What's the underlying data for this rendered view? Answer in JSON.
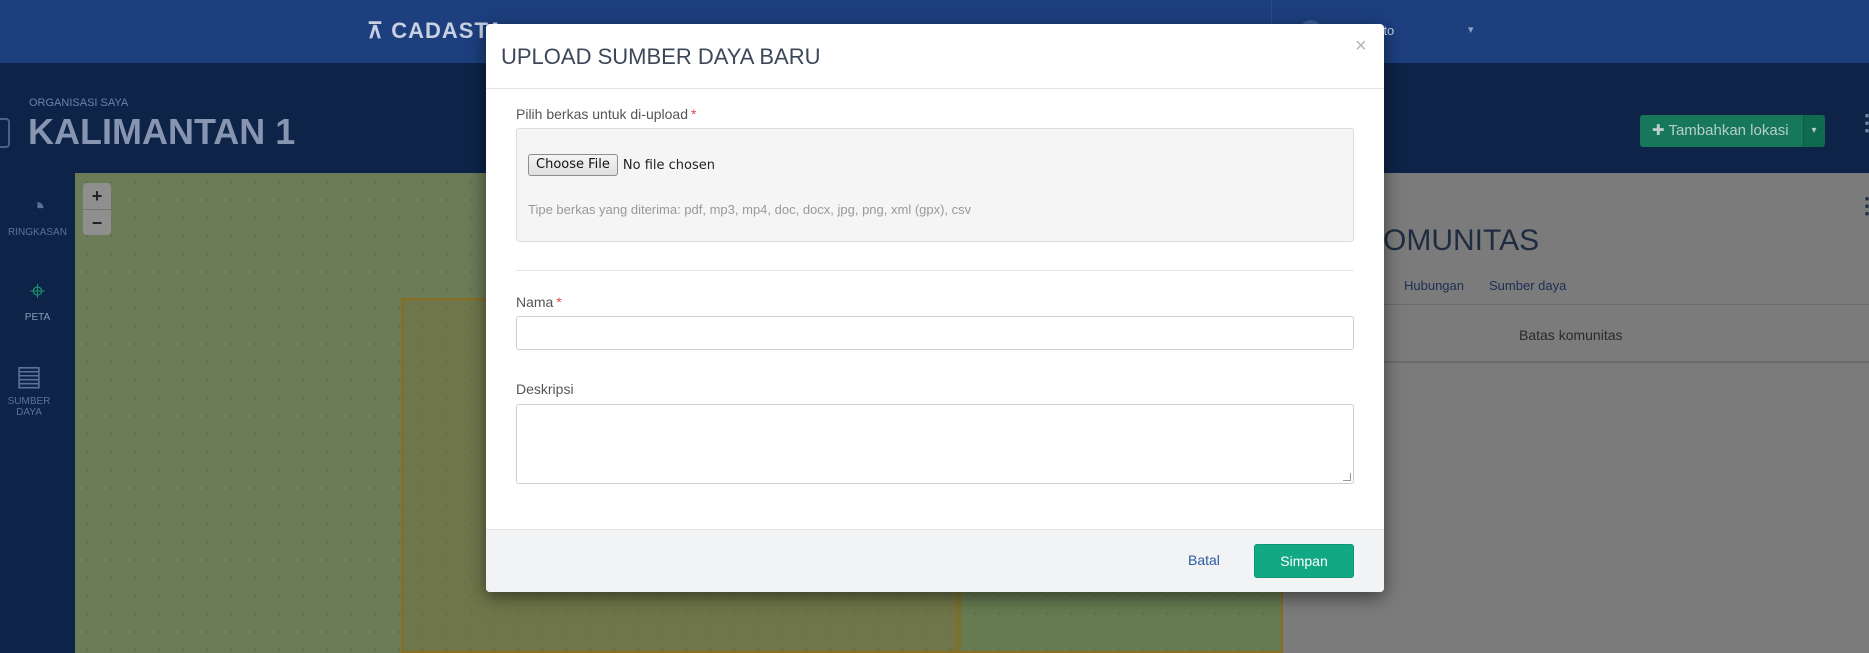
{
  "app": {
    "brand": "⊼ CADASTA",
    "user_name": "mir Hartato",
    "user_caret": "▾"
  },
  "header": {
    "org_label": "ORGANISASI SAYA",
    "project_title": "KALIMANTAN 1",
    "add_location_label": "✚ Tambahkan lokasi",
    "add_location_caret": "▾",
    "kebab": "⋮"
  },
  "sidebar": {
    "items": [
      {
        "label": "RINGKASAN",
        "icon": "dashboard-icon",
        "glyph": "◔"
      },
      {
        "label": "PETA",
        "icon": "map-pin-icon",
        "glyph": "⌖"
      },
      {
        "label": "SUMBER DAYA",
        "icon": "document-attachment-icon",
        "glyph": "▤"
      }
    ]
  },
  "map": {
    "zoom_in": "+",
    "zoom_out": "−"
  },
  "right_panel": {
    "title": "KOMUNITAS",
    "kebab": "⋮",
    "tabs": [
      "Hubungan",
      "Sumber daya"
    ],
    "sub_text": "Batas komunitas"
  },
  "modal": {
    "title": "UPLOAD SUMBER DAYA BARU",
    "close": "×",
    "file_label": "Pilih berkas untuk di-upload",
    "required_mark": "*",
    "choose_file": "Choose File",
    "no_file": "No file chosen",
    "file_hint": "Tipe berkas yang diterima: pdf, mp3, mp4, doc, docx, jpg, png, xml (gpx), csv",
    "name_label": "Nama",
    "name_value": "",
    "description_label": "Deskripsi",
    "description_value": "",
    "cancel": "Batal",
    "save": "Simpan"
  },
  "colors": {
    "nav": "#1d3f7e",
    "header": "#0e2348",
    "primary_button": "#11a883",
    "link": "#2c5aa0",
    "required": "#e14d4d"
  }
}
